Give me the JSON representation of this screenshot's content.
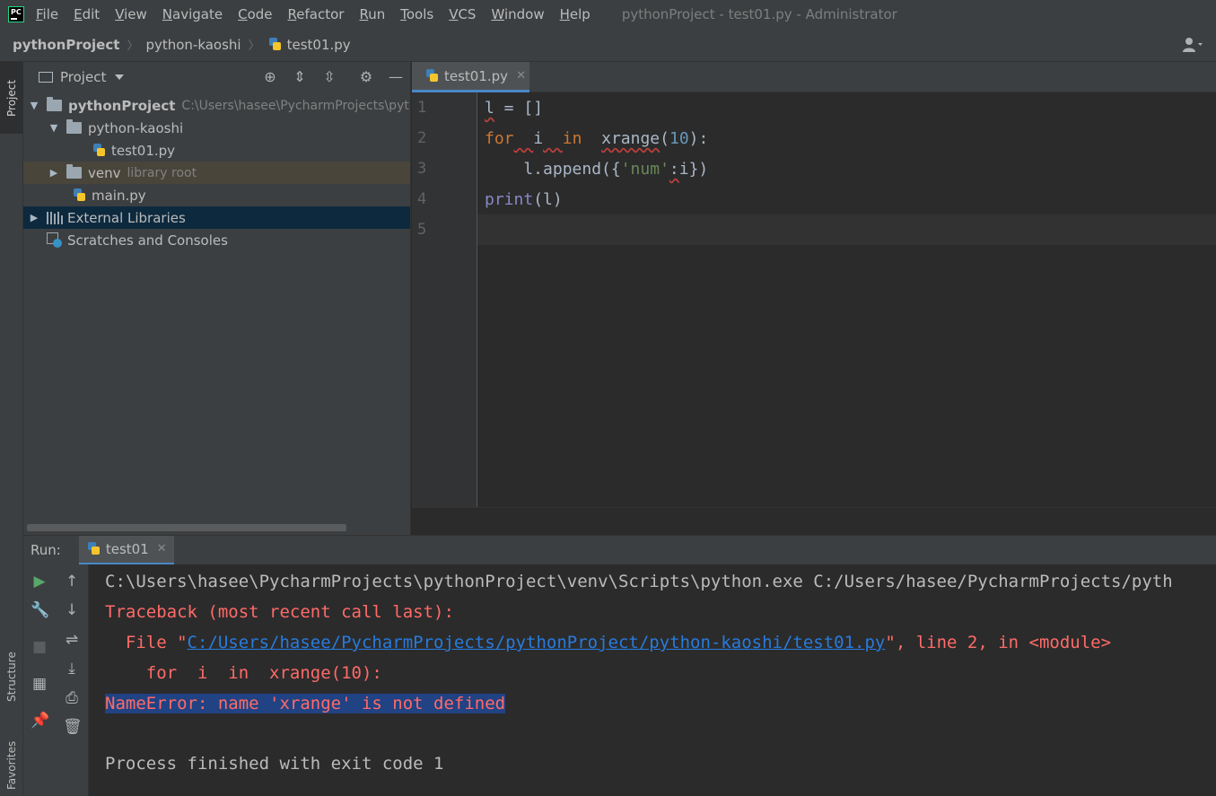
{
  "menubar": {
    "items": [
      {
        "label": "File",
        "mnemonic": "F",
        "rest": "ile"
      },
      {
        "label": "Edit",
        "mnemonic": "E",
        "rest": "dit"
      },
      {
        "label": "View",
        "mnemonic": "V",
        "rest": "iew"
      },
      {
        "label": "Navigate",
        "mnemonic": "N",
        "rest": "avigate"
      },
      {
        "label": "Code",
        "mnemonic": "C",
        "rest": "ode"
      },
      {
        "label": "Refactor",
        "mnemonic": "R",
        "rest": "efactor"
      },
      {
        "label": "Run",
        "mnemonic": "R",
        "rest": "un"
      },
      {
        "label": "Tools",
        "mnemonic": "T",
        "rest": "ools"
      },
      {
        "label": "VCS",
        "mnemonic": "V",
        "rest": "CS"
      },
      {
        "label": "Window",
        "mnemonic": "W",
        "rest": "indow"
      },
      {
        "label": "Help",
        "mnemonic": "H",
        "rest": "elp"
      }
    ],
    "window_title": "pythonProject - test01.py - Administrator",
    "logo_text": "PC"
  },
  "breadcrumb": [
    "pythonProject",
    "python-kaoshi",
    "test01.py"
  ],
  "left_strip": {
    "project_tab": "Project",
    "structure_tab": "Structure",
    "favorites_tab": "Favorites"
  },
  "project_panel": {
    "title": "Project",
    "tree": {
      "root_label": "pythonProject",
      "root_path": "C:\\Users\\hasee\\PycharmProjects\\pyt",
      "folder1": "python-kaoshi",
      "file1": "test01.py",
      "venv": "venv",
      "venv_hint": "library root",
      "file2": "main.py",
      "ext_libs": "External Libraries",
      "scratches": "Scratches and Consoles"
    }
  },
  "editor": {
    "tab_label": "test01.py",
    "line_numbers": [
      "1",
      "2",
      "3",
      "4",
      "5"
    ],
    "code": {
      "l1_var": "l",
      "l1_rest": " = []",
      "l2_for": "for",
      "l2_i": "i",
      "l2_in": "in",
      "l2_fn": "xrange",
      "l2_open": "(",
      "l2_num": "10",
      "l2_close": "):",
      "l3_pre": "    l.append({",
      "l3_str": "'num'",
      "l3_colon": ":",
      "l3_end": "i})",
      "l4_fn": "print",
      "l4_rest": "(l)"
    }
  },
  "run": {
    "label": "Run:",
    "tab_label": "test01",
    "console": {
      "cmd": "C:\\Users\\hasee\\PycharmProjects\\pythonProject\\venv\\Scripts\\python.exe C:/Users/hasee/PycharmProjects/pyth",
      "traceback": "Traceback (most recent call last):",
      "file_prefix": "  File \"",
      "file_link": "C:/Users/hasee/PycharmProjects/pythonProject/python-kaoshi/test01.py",
      "file_suffix": "\", line 2, in <module>",
      "code_echo": "    for  i  in  xrange(10):",
      "error": "NameError: name 'xrange' is not defined",
      "exit": "Process finished with exit code 1"
    }
  },
  "colors": {
    "keyword": "#cc7832",
    "number": "#6897bb",
    "string": "#6a8759",
    "builtin": "#8888c6",
    "error_text": "#ff6b68",
    "link": "#287bde",
    "selection": "#214283"
  }
}
